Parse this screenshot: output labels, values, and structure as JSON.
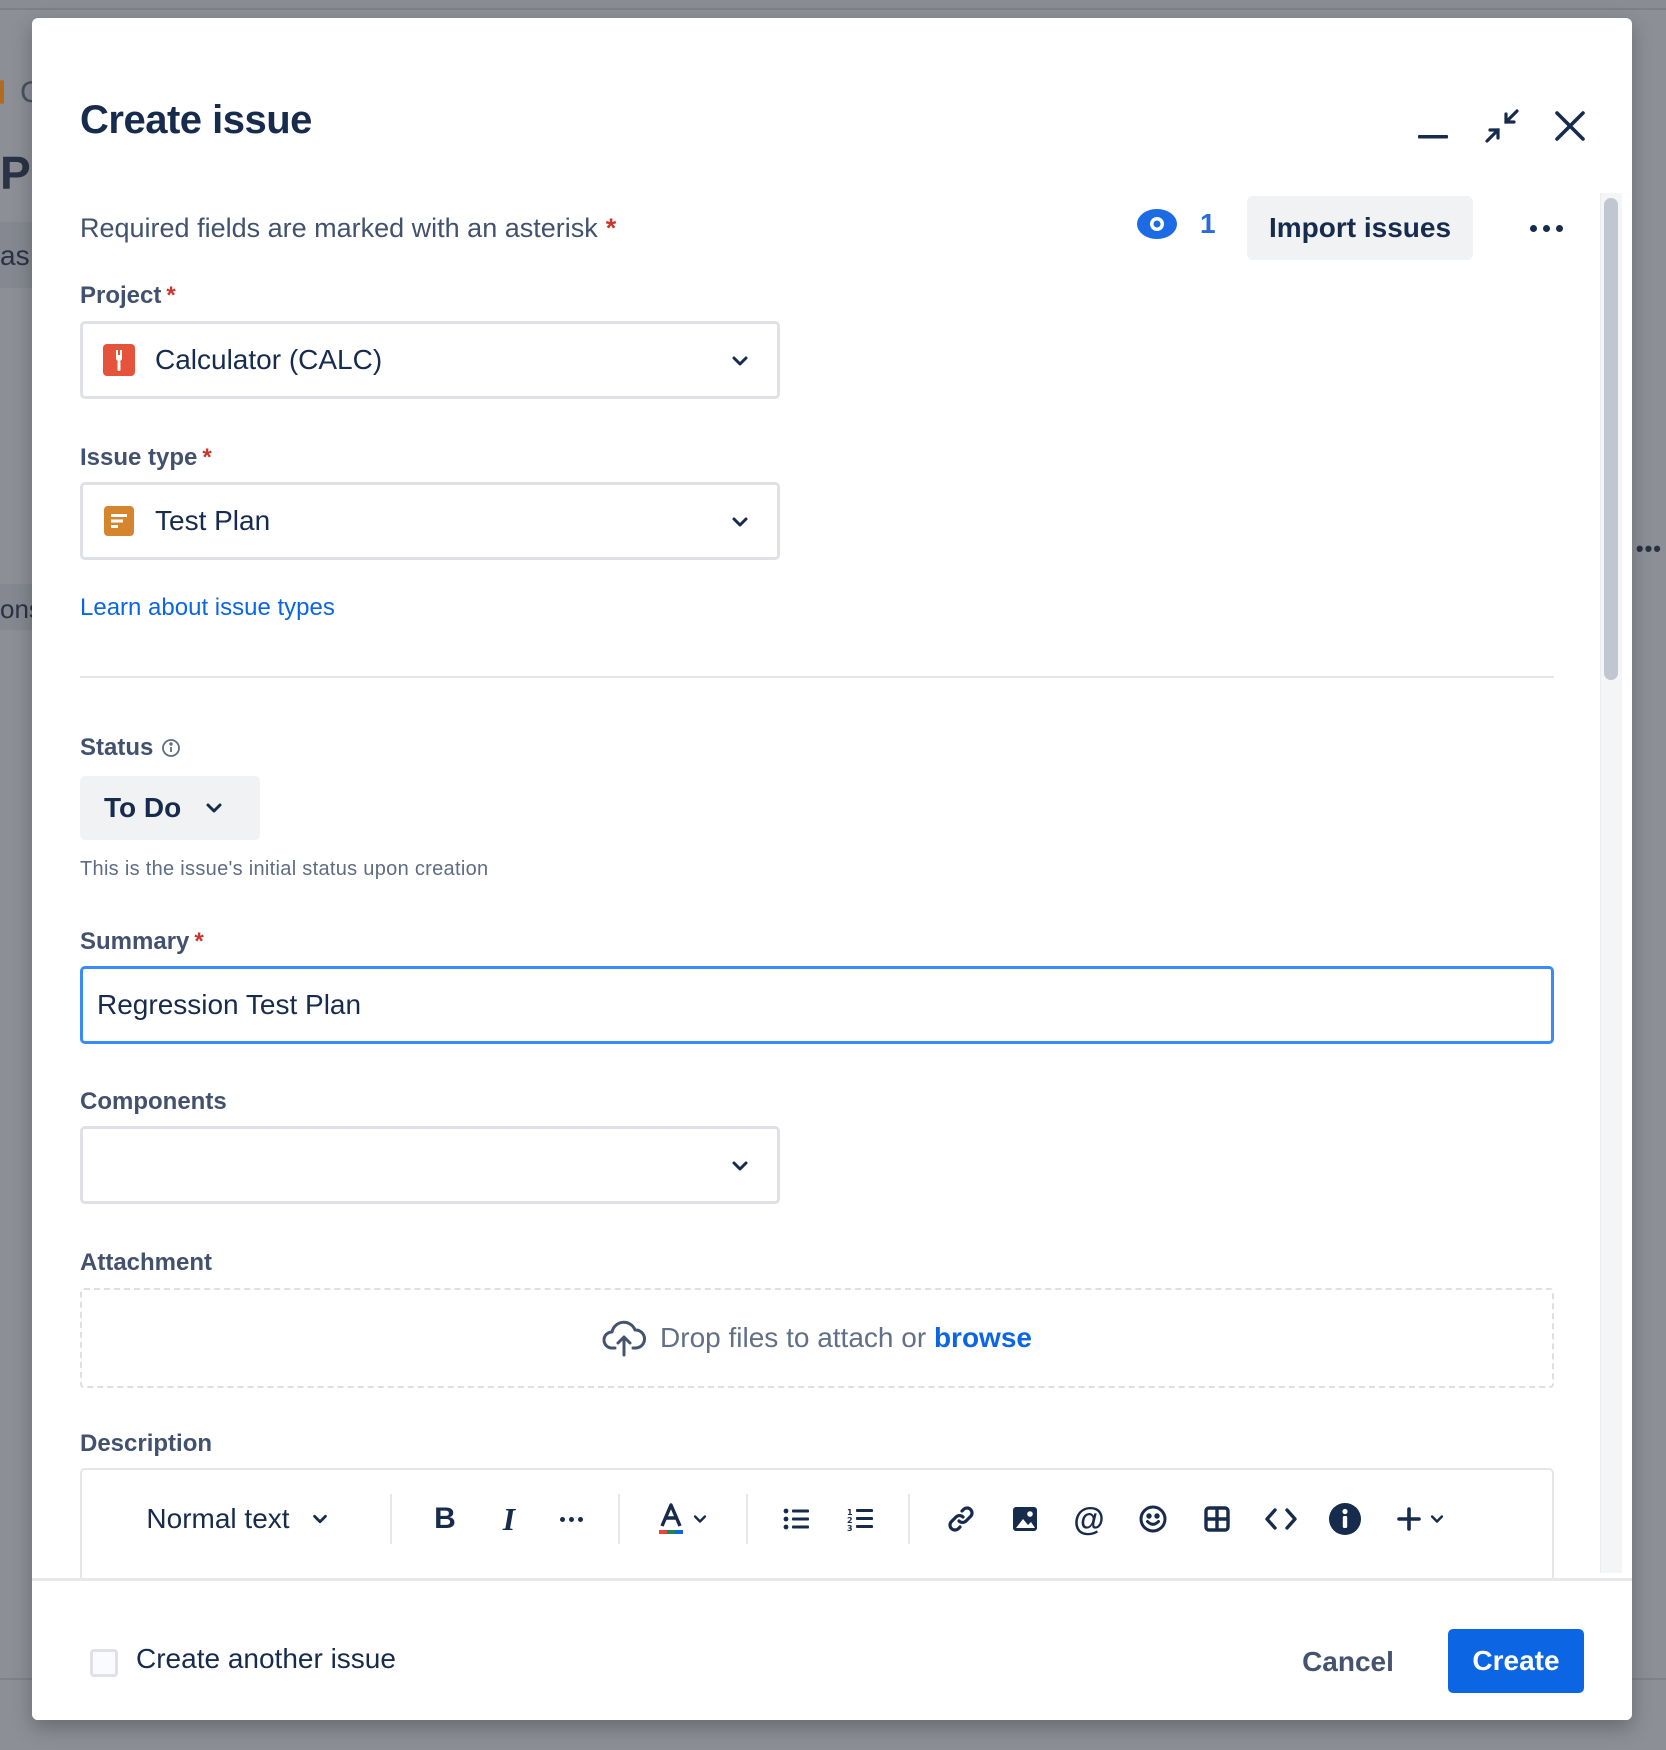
{
  "background": {
    "fragments": [
      "C",
      "Pl",
      "as",
      "ons"
    ]
  },
  "modal": {
    "title": "Create issue",
    "required_note": "Required fields are marked with an asterisk",
    "required_star": "*",
    "watchers_count": "1",
    "import_label": "Import issues"
  },
  "project": {
    "label": "Project",
    "value": "Calculator (CALC)"
  },
  "issue_type": {
    "label": "Issue type",
    "value": "Test Plan",
    "learn_link": "Learn about issue types"
  },
  "status": {
    "label": "Status",
    "value": "To Do",
    "helper": "This is the issue's initial status upon creation"
  },
  "summary": {
    "label": "Summary",
    "value": "Regression Test Plan"
  },
  "components": {
    "label": "Components",
    "value": ""
  },
  "attachment": {
    "label": "Attachment",
    "drop_text": "Drop files to attach or",
    "browse_text": "browse"
  },
  "description": {
    "label": "Description",
    "text_style": "Normal text"
  },
  "footer": {
    "create_another_label": "Create another issue",
    "cancel_label": "Cancel",
    "create_label": "Create"
  },
  "colors": {
    "primary": "#0c66e4",
    "required": "#c9372c",
    "focus_border": "#388bff",
    "project_icon": "#e5533a",
    "issue_type_icon": "#d5852e"
  },
  "icons": {
    "minimize": "minimize-icon",
    "collapse": "collapse-icon",
    "close": "close-icon",
    "watch": "eye-icon",
    "more": "more-icon",
    "info": "info-icon",
    "upload": "cloud-upload-icon"
  }
}
